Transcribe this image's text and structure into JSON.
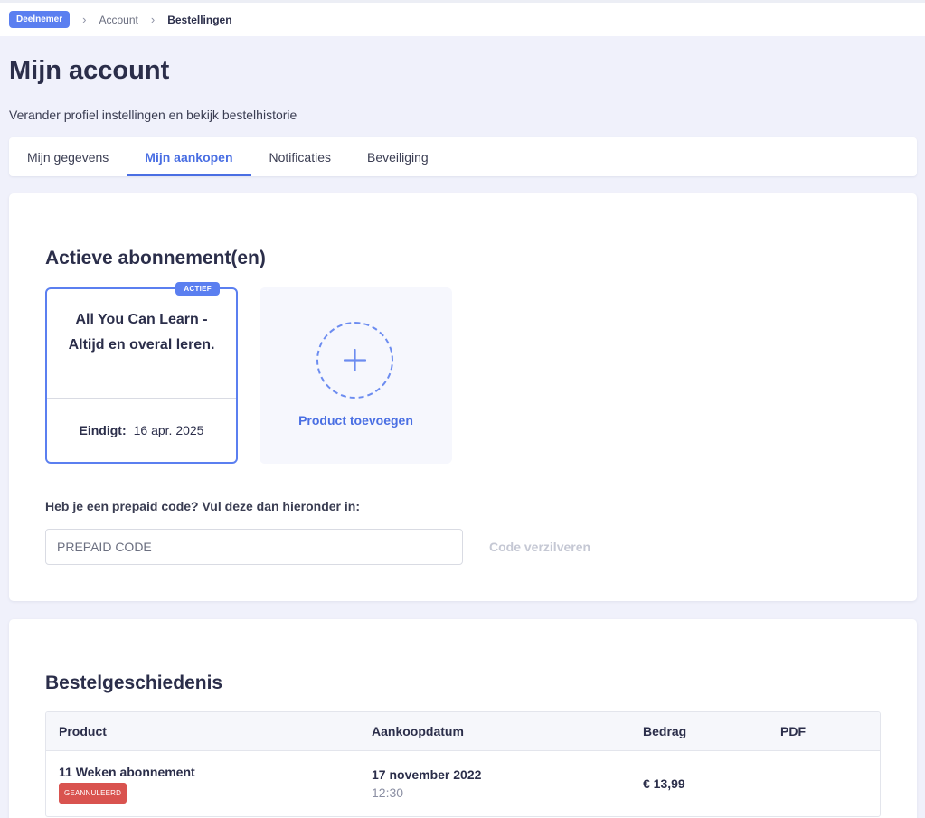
{
  "breadcrumb": {
    "role_badge": "Deelnemer",
    "items": [
      "Account",
      "Bestellingen"
    ]
  },
  "page": {
    "title": "Mijn account",
    "subtitle": "Verander profiel instellingen en bekijk bestelhistorie"
  },
  "tabs": [
    {
      "label": "Mijn gegevens",
      "active": false
    },
    {
      "label": "Mijn aankopen",
      "active": true
    },
    {
      "label": "Notificaties",
      "active": false
    },
    {
      "label": "Beveiliging",
      "active": false
    }
  ],
  "subscriptions": {
    "title": "Actieve abonnement(en)",
    "active_badge": "ACTIEF",
    "name": "All You Can Learn - Altijd en overal leren.",
    "end_label": "Eindigt:",
    "end_date": "16 apr. 2025",
    "add_label": "Product toevoegen"
  },
  "prepaid": {
    "question": "Heb je een prepaid code? Vul deze dan hieronder in:",
    "placeholder": "PREPAID CODE",
    "value": "",
    "redeem_label": "Code verzilveren"
  },
  "orders": {
    "title": "Bestelgeschiedenis",
    "columns": [
      "Product",
      "Aankoopdatum",
      "Bedrag",
      "PDF"
    ],
    "rows": [
      {
        "product": "11 Weken abonnement",
        "status": "GEANNULEERD",
        "date": "17 november 2022",
        "time": "12:30",
        "amount": "€ 13,99"
      }
    ]
  },
  "colors": {
    "accent": "#4a6fe3",
    "background": "#f0f1fb",
    "cancelled": "#d9534f"
  }
}
